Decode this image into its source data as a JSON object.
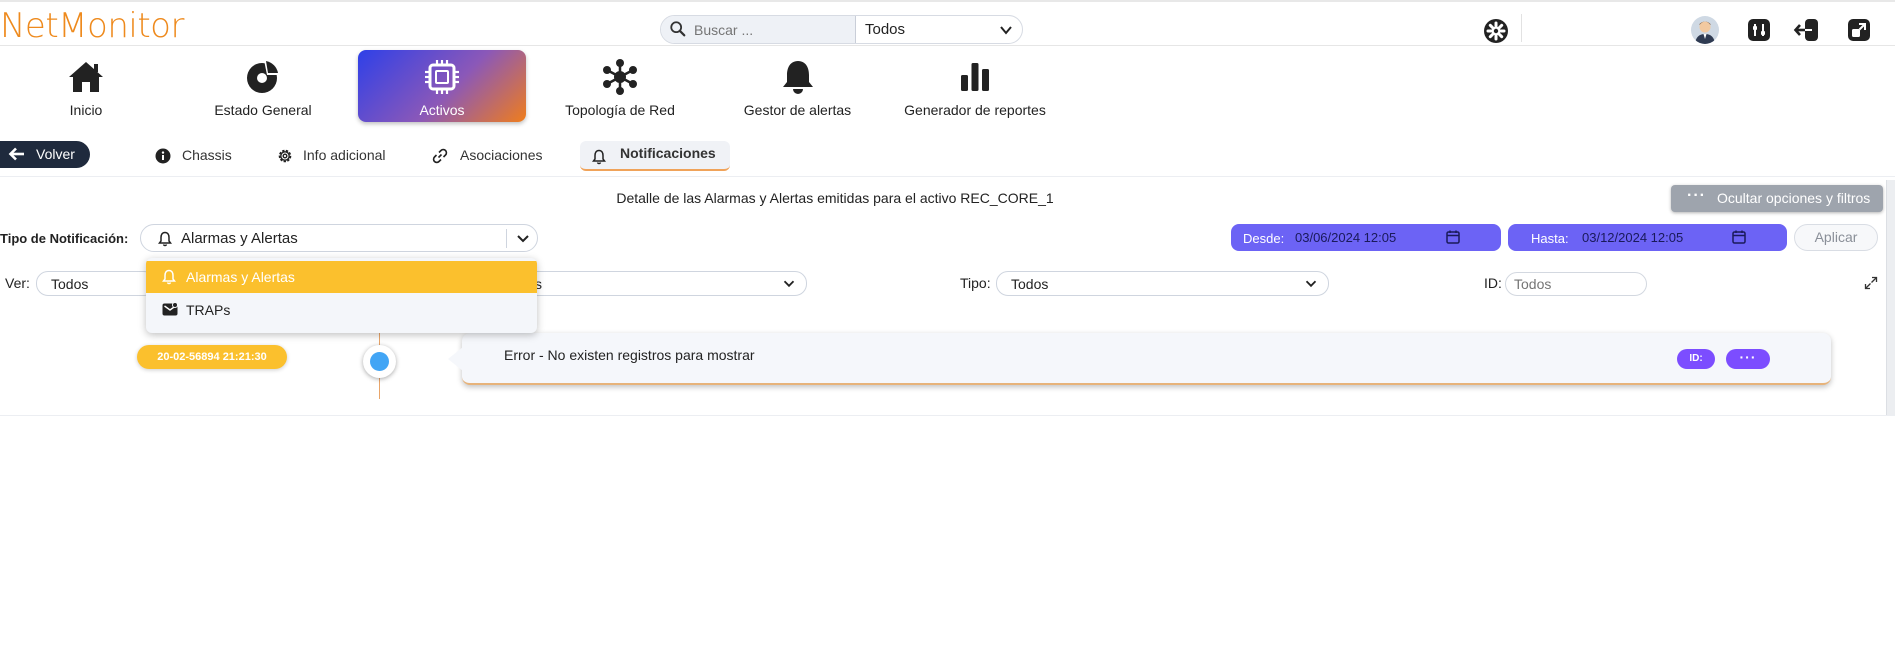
{
  "app": {
    "logo": "NetMonitor"
  },
  "header": {
    "search_placeholder": "Buscar ...",
    "search_scope": "Todos"
  },
  "nav": {
    "items": [
      {
        "label": "Inicio",
        "icon": "home-icon"
      },
      {
        "label": "Estado General",
        "icon": "pie-chart-icon"
      },
      {
        "label": "Activos",
        "icon": "chip-icon",
        "active": true
      },
      {
        "label": "Topología de Red",
        "icon": "network-icon"
      },
      {
        "label": "Gestor de alertas",
        "icon": "bell-icon"
      },
      {
        "label": "Generador de reportes",
        "icon": "bar-chart-icon"
      }
    ]
  },
  "subnav": {
    "back_label": "Volver",
    "tabs": [
      {
        "label": "Chassis",
        "icon": "info-icon"
      },
      {
        "label": "Info adicional",
        "icon": "gear-icon"
      },
      {
        "label": "Asociaciones",
        "icon": "link-icon"
      },
      {
        "label": "Notificaciones",
        "icon": "bell-icon",
        "active": true
      }
    ]
  },
  "content": {
    "title": "Detalle de las Alarmas y Alertas emitidas para el activo REC_CORE_1",
    "hide_options_label": "Ocultar opciones y filtros",
    "hide_options_dots": "···",
    "notif_type_label": "Tipo de Notificación:",
    "notif_type_value": "Alarmas y Alertas",
    "desde_label": "Desde:",
    "desde_value": "03/06/2024 12:05",
    "hasta_label": "Hasta:",
    "hasta_value": "03/12/2024 12:05",
    "apply_label": "Aplicar",
    "filters": {
      "ver_label": "Ver:",
      "ver_value": "Todos",
      "second_value": "s",
      "tipo_label": "Tipo:",
      "tipo_value": "Todos",
      "id_label": "ID:",
      "id_placeholder": "Todos"
    },
    "dropdown_options": [
      {
        "label": "Alarmas y Alertas",
        "icon": "bell-icon",
        "selected": true
      },
      {
        "label": "TRAPs",
        "icon": "mail-icon",
        "selected": false
      }
    ],
    "timeline": {
      "timestamp": "20-02-56894 21:21:30",
      "message": "Error - No existen registros para mostrar",
      "id_chip": "ID:",
      "more_chip": "···"
    }
  },
  "colors": {
    "brand": "#ee8a1d",
    "accent_purple": "#6c63f5",
    "chip_purple": "#7c4dff",
    "highlight_yellow": "#fbc02d",
    "back_button": "#1f2a3d",
    "timeline_dot": "#42a5f5"
  }
}
